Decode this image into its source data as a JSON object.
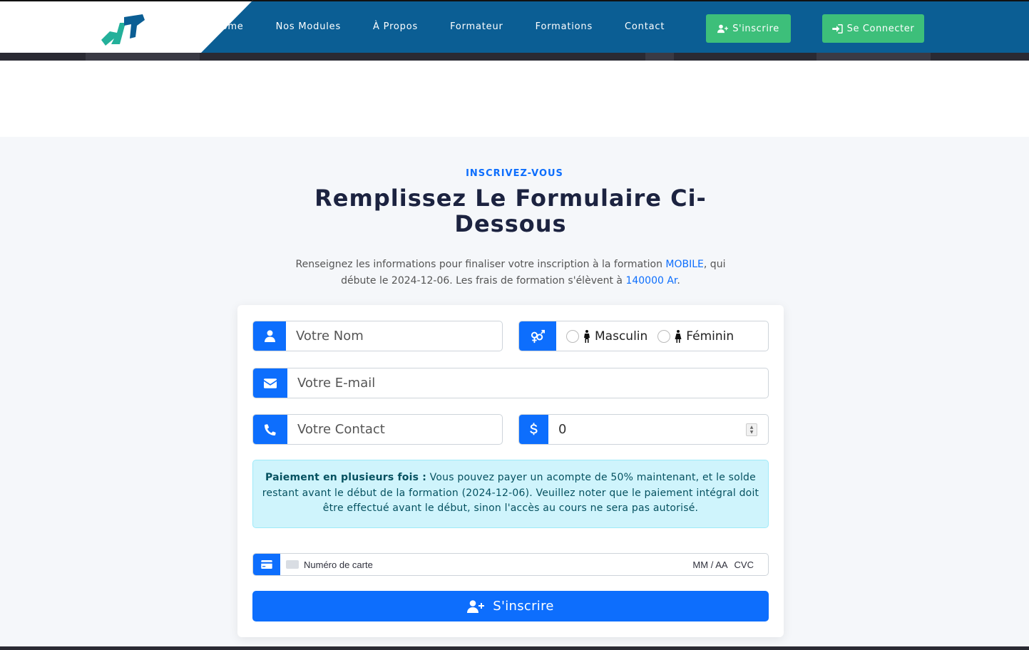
{
  "colors": {
    "nav_bg": "#0b5e94",
    "accent": "#0d6efd",
    "nav_button": "#3dbf7a",
    "alert_bg": "#cff4fc",
    "alert_text": "#055160"
  },
  "header": {
    "logo_icon": "logo-mark",
    "nav": [
      "Home",
      "Nos Modules",
      "À Propos",
      "Formateur",
      "Formations",
      "Contact"
    ],
    "signup_label": "S'inscrire",
    "login_label": "Se Connecter"
  },
  "section": {
    "eyebrow": "INSCRIVEZ-VOUS",
    "title": "Remplissez Le Formulaire Ci-Dessous",
    "desc_part1": "Renseignez les informations pour finaliser votre inscription à la formation ",
    "course_name": "MOBILE",
    "desc_part2": ", qui débute le 2024-12-06. Les frais de formation s'élèvent à ",
    "fee": "140000 Ar",
    "desc_part3": "."
  },
  "form": {
    "name_placeholder": "Votre Nom",
    "gender_options": [
      "Masculin",
      "Féminin"
    ],
    "email_placeholder": "Votre E-mail",
    "contact_placeholder": "Votre Contact",
    "amount_value": "0",
    "alert_bold": "Paiement en plusieurs fois :",
    "alert_text": " Vous pouvez payer un acompte de 50% maintenant, et le solde restant avant le début de la formation (2024-12-06). Veuillez noter que le paiement intégral doit être effectué avant le début, sinon l'accès au cours ne sera pas autorisé.",
    "card_number_placeholder": "Numéro de carte",
    "card_expiry_placeholder": "MM / AA",
    "card_cvc_placeholder": "CVC",
    "submit_label": "S'inscrire"
  }
}
